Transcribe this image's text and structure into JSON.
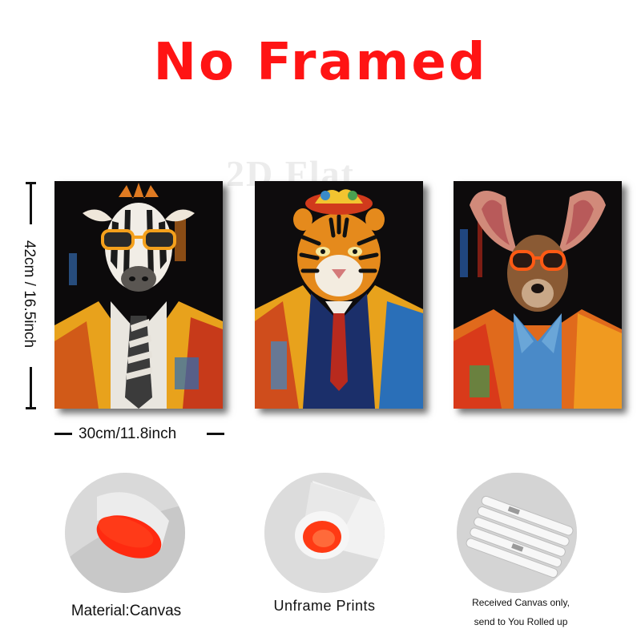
{
  "headline": "No Framed",
  "dimensions": {
    "height_label": "42cm / 16.5inch",
    "width_label": "30cm/11.8inch"
  },
  "posters": [
    {
      "subject": "zebra"
    },
    {
      "subject": "tiger"
    },
    {
      "subject": "kangaroo"
    }
  ],
  "features": [
    {
      "caption": "Material:Canvas"
    },
    {
      "caption": "Unframe  Prints"
    },
    {
      "caption_line1": "Received Canvas only,",
      "caption_line2": "send to You Rolled up"
    }
  ],
  "colors": {
    "headline": "#ff1414",
    "canvas_core": "#ff2a10"
  },
  "watermark_text": "2D Flat"
}
